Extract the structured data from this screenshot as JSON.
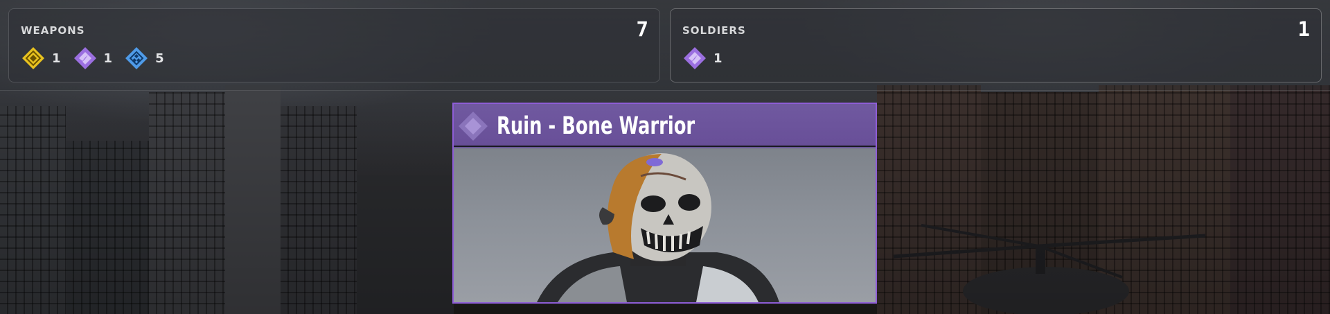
{
  "colors": {
    "legendary": "#e8c21f",
    "epic": "#9b6fe0",
    "rare": "#4f9be8",
    "card_border": "#8e5dd6",
    "card_header": "#6b529b"
  },
  "panels": {
    "weapons": {
      "title": "WEAPONS",
      "total": "7",
      "rarities": [
        {
          "rarity": "legendary",
          "icon": "legendary-rarity-icon",
          "count": "1"
        },
        {
          "rarity": "epic",
          "icon": "epic-rarity-icon",
          "count": "1"
        },
        {
          "rarity": "rare",
          "icon": "rare-rarity-icon",
          "count": "5"
        }
      ]
    },
    "soldiers": {
      "title": "SOLDIERS",
      "total": "1",
      "rarities": [
        {
          "rarity": "epic",
          "icon": "epic-rarity-icon",
          "count": "1"
        }
      ]
    }
  },
  "reward_card": {
    "name": "Ruin - Bone Warrior",
    "rarity": "epic",
    "rarity_icon": "epic-rarity-icon",
    "image": "operator-portrait-skull-mask"
  }
}
